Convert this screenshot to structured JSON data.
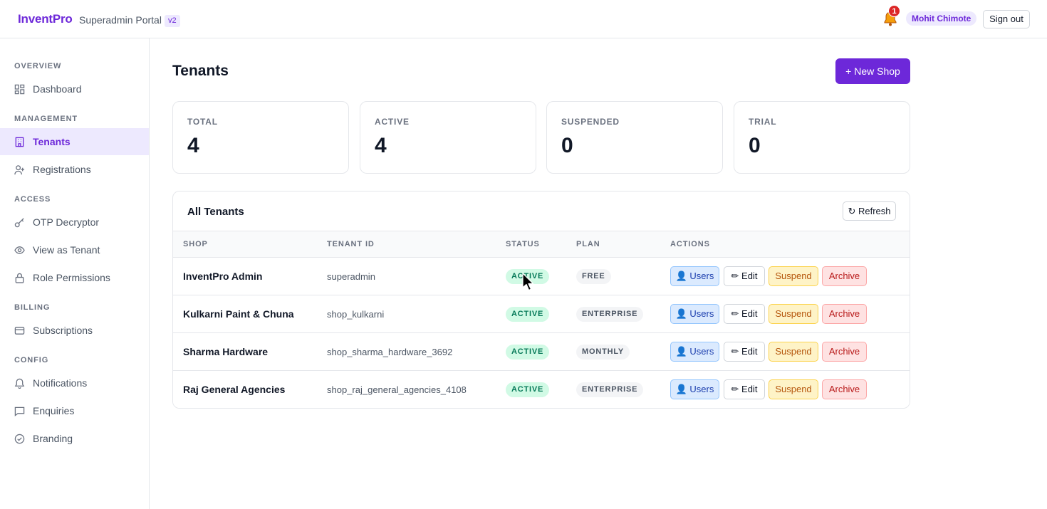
{
  "header": {
    "brand": "InventPro",
    "portal": "Superadmin Portal",
    "version": "v2",
    "notification_count": "1",
    "user": "Mohit Chimote",
    "signout_label": "Sign out"
  },
  "sidebar": {
    "sections": [
      {
        "label": "OVERVIEW",
        "items": [
          {
            "label": "Dashboard",
            "icon": "dashboard-icon"
          }
        ]
      },
      {
        "label": "MANAGEMENT",
        "items": [
          {
            "label": "Tenants",
            "icon": "building-icon",
            "active": true
          },
          {
            "label": "Registrations",
            "icon": "user-plus-icon"
          }
        ]
      },
      {
        "label": "ACCESS",
        "items": [
          {
            "label": "OTP Decryptor",
            "icon": "key-icon"
          },
          {
            "label": "View as Tenant",
            "icon": "eye-icon"
          },
          {
            "label": "Role Permissions",
            "icon": "lock-icon"
          }
        ]
      },
      {
        "label": "BILLING",
        "items": [
          {
            "label": "Subscriptions",
            "icon": "credit-card-icon"
          }
        ]
      },
      {
        "label": "CONFIG",
        "items": [
          {
            "label": "Notifications",
            "icon": "bell-icon"
          },
          {
            "label": "Enquiries",
            "icon": "message-icon"
          },
          {
            "label": "Branding",
            "icon": "check-circle-icon"
          }
        ]
      }
    ]
  },
  "main": {
    "title": "Tenants",
    "new_shop_label": "+ New Shop",
    "stats": [
      {
        "label": "TOTAL",
        "value": "4"
      },
      {
        "label": "ACTIVE",
        "value": "4"
      },
      {
        "label": "SUSPENDED",
        "value": "0"
      },
      {
        "label": "TRIAL",
        "value": "0"
      }
    ],
    "table": {
      "title": "All Tenants",
      "refresh_label": "↻ Refresh",
      "columns": [
        "SHOP",
        "TENANT ID",
        "STATUS",
        "PLAN",
        "ACTIONS"
      ],
      "rows": [
        {
          "shop": "InventPro Admin",
          "tenant_id": "superadmin",
          "status": "ACTIVE",
          "plan": "FREE"
        },
        {
          "shop": "Kulkarni Paint & Chuna",
          "tenant_id": "shop_kulkarni",
          "status": "ACTIVE",
          "plan": "ENTERPRISE"
        },
        {
          "shop": "Sharma Hardware",
          "tenant_id": "shop_sharma_hardware_3692",
          "status": "ACTIVE",
          "plan": "MONTHLY"
        },
        {
          "shop": "Raj General Agencies",
          "tenant_id": "shop_raj_general_agencies_4108",
          "status": "ACTIVE",
          "plan": "ENTERPRISE"
        }
      ],
      "actions": {
        "users": "👤 Users",
        "edit": "✏ Edit",
        "suspend": "Suspend",
        "archive": "Archive"
      }
    }
  },
  "colors": {
    "accent": "#6d28d9",
    "status_active": "#047857",
    "danger": "#b91c1c",
    "warning": "#b45309",
    "info": "#1e40af"
  }
}
